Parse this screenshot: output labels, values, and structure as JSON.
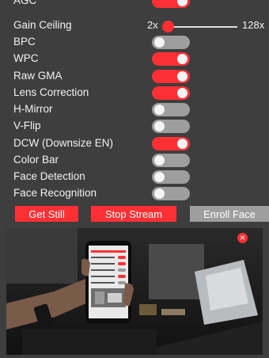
{
  "controls": {
    "agc": {
      "label": "AGC",
      "state": "on"
    },
    "gain_ceiling": {
      "label": "Gain Ceiling",
      "min_label": "2x",
      "max_label": "128x",
      "value_fraction": 0.0
    },
    "bpc": {
      "label": "BPC",
      "state": "off"
    },
    "wpc": {
      "label": "WPC",
      "state": "on"
    },
    "raw_gma": {
      "label": "Raw GMA",
      "state": "on"
    },
    "lens_correction": {
      "label": "Lens Correction",
      "state": "on"
    },
    "h_mirror": {
      "label": "H-Mirror",
      "state": "off"
    },
    "v_flip": {
      "label": "V-Flip",
      "state": "off"
    },
    "dcw": {
      "label": "DCW (Downsize EN)",
      "state": "on"
    },
    "color_bar": {
      "label": "Color Bar",
      "state": "off"
    },
    "face_detection": {
      "label": "Face Detection",
      "state": "off"
    },
    "face_recognition": {
      "label": "Face Recognition",
      "state": "off"
    }
  },
  "buttons": {
    "get_still": "Get Still",
    "stop_stream": "Stop Stream",
    "enroll_face": "Enroll Face"
  },
  "stream": {
    "close_glyph": "×"
  },
  "colors": {
    "panel": "#3e3e3e",
    "accent": "#ff3034",
    "toggle_off": "#9e9e9e",
    "button_disabled": "#9e9e9e"
  }
}
